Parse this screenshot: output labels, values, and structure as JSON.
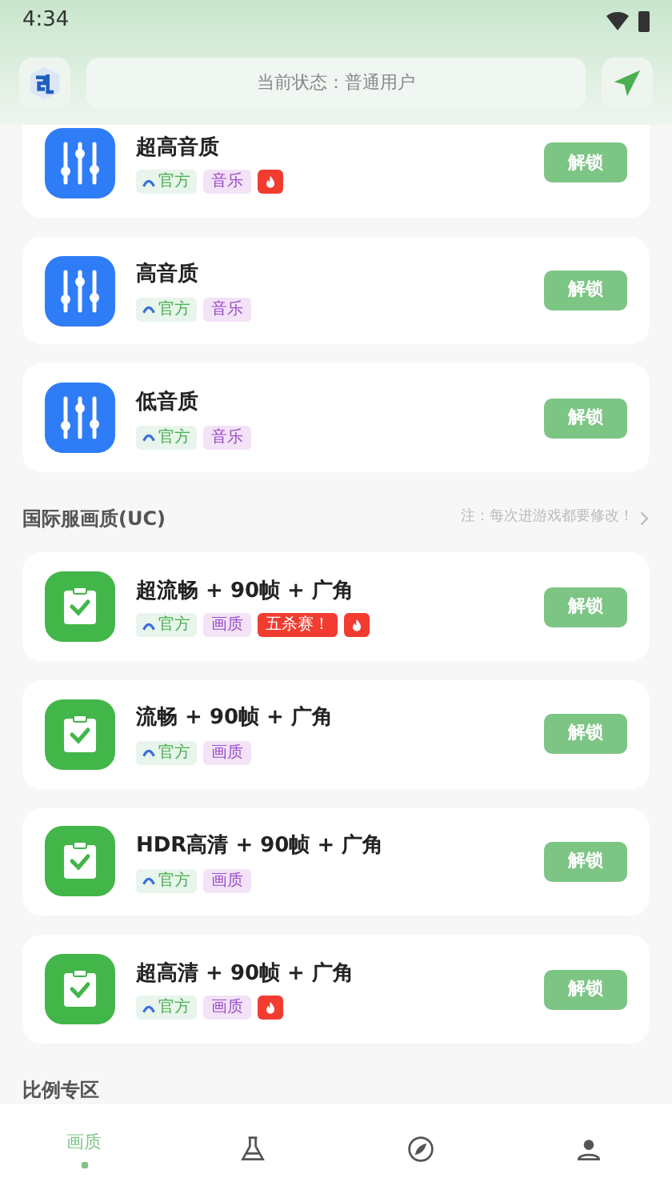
{
  "status_bar": {
    "time": "4:34"
  },
  "header": {
    "status_text": "当前状态：普通用户"
  },
  "sections": [
    {
      "items": [
        {
          "name": "超高音质",
          "kind": "equalizer",
          "button": "解锁",
          "tags": [
            {
              "kind": "official",
              "text": "官方"
            },
            {
              "kind": "category",
              "text": "音乐"
            },
            {
              "kind": "hot"
            }
          ]
        },
        {
          "name": "高音质",
          "kind": "equalizer",
          "button": "解锁",
          "tags": [
            {
              "kind": "official",
              "text": "官方"
            },
            {
              "kind": "category",
              "text": "音乐"
            }
          ]
        },
        {
          "name": "低音质",
          "kind": "equalizer",
          "button": "解锁",
          "tags": [
            {
              "kind": "official",
              "text": "官方"
            },
            {
              "kind": "category",
              "text": "音乐"
            }
          ]
        }
      ]
    },
    {
      "title": "国际服画质(UC)",
      "note": "注：每次进游戏都要修改！",
      "items": [
        {
          "name": "超流畅 + 90帧 + 广角",
          "kind": "clipboard",
          "button": "解锁",
          "tags": [
            {
              "kind": "official",
              "text": "官方"
            },
            {
              "kind": "category",
              "text": "画质"
            },
            {
              "kind": "promo",
              "text": "五杀赛！"
            },
            {
              "kind": "hot"
            }
          ]
        },
        {
          "name": "流畅 + 90帧 + 广角",
          "kind": "clipboard",
          "button": "解锁",
          "tags": [
            {
              "kind": "official",
              "text": "官方"
            },
            {
              "kind": "category",
              "text": "画质"
            }
          ]
        },
        {
          "name": "HDR高清 + 90帧 + 广角",
          "kind": "clipboard",
          "button": "解锁",
          "tags": [
            {
              "kind": "official",
              "text": "官方"
            },
            {
              "kind": "category",
              "text": "画质"
            }
          ]
        },
        {
          "name": "超高清 + 90帧 + 广角",
          "kind": "clipboard",
          "button": "解锁",
          "tags": [
            {
              "kind": "official",
              "text": "官方"
            },
            {
              "kind": "category",
              "text": "画质"
            },
            {
              "kind": "hot"
            }
          ]
        }
      ]
    },
    {
      "title": "比例专区"
    }
  ],
  "nav": [
    {
      "kind": "quality",
      "label": "画质",
      "selected": true
    },
    {
      "kind": "lab",
      "selected": false
    },
    {
      "kind": "leaf",
      "selected": false
    },
    {
      "kind": "profile",
      "selected": false
    }
  ]
}
